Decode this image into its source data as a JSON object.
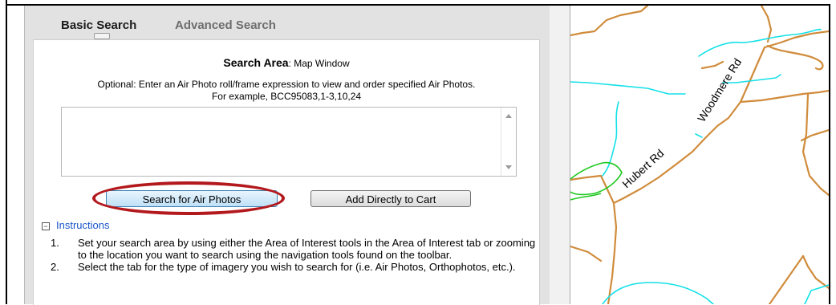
{
  "tabs": {
    "basic": "Basic Search",
    "advanced": "Advanced Search"
  },
  "search_area": {
    "label": "Search Area",
    "value": ": Map Window"
  },
  "optional_text": {
    "line1": "Optional: Enter an Air Photo roll/frame expression to view and order specified Air Photos.",
    "line2": "For example, BCC95083,1-3,10,24"
  },
  "expression_input": {
    "value": ""
  },
  "buttons": {
    "search": "Search for Air Photos",
    "add_cart": "Add Directly to Cart"
  },
  "instructions": {
    "toggle": "−",
    "heading": "Instructions",
    "steps": [
      {
        "num": "1.",
        "text": "Set your search area by using either the Area of Interest tools in the Area of Interest tab or zooming to the location you want to search using the navigation tools found on the toolbar."
      },
      {
        "num": "2.",
        "text": "Select the tab for the type of imagery you wish to search for (i.e. Air Photos, Orthophotos, etc.)."
      }
    ]
  },
  "map": {
    "roads": [
      "Woodmere Rd",
      "Hubert Rd"
    ],
    "colors": {
      "road": "#d08c3c",
      "water": "#14e0e8",
      "green": "#1ec81e",
      "highlight": "#b3181d"
    }
  }
}
